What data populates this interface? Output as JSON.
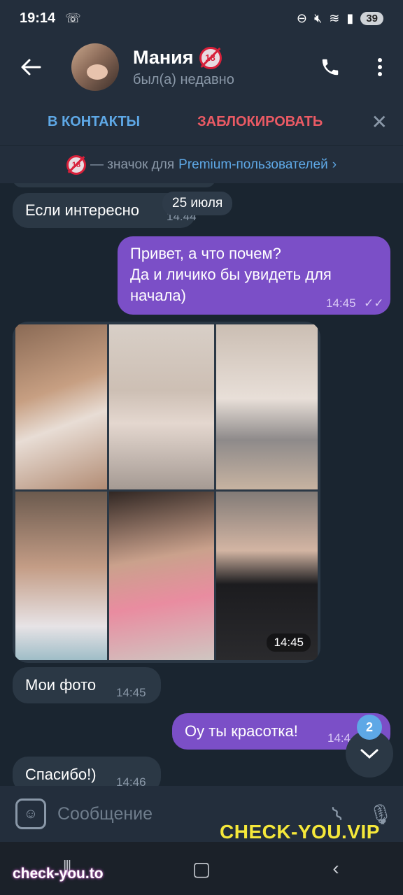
{
  "status_bar": {
    "time": "19:14",
    "battery": "39"
  },
  "header": {
    "back_icon": "arrow-left-icon",
    "name": "Мания",
    "badge_text": "18",
    "status": "был(а) недавно",
    "call_icon": "phone-icon",
    "menu_icon": "more-vertical-icon"
  },
  "actions": {
    "add_contact": "В КОНТАКТЫ",
    "block": "ЗАБЛОКИРОВАТЬ",
    "close": "✕"
  },
  "premium_banner": {
    "badge_text": "18",
    "text": " — значок для ",
    "link": "Premium-пользователей",
    "chevron": "›"
  },
  "date_pill": "25 июля",
  "messages": [
    {
      "direction": "in",
      "text": "Если интересно",
      "time": "14:44"
    },
    {
      "direction": "out",
      "lines": [
        "Привет, а что почем?",
        "Да и личико  бы увидеть для",
        "начала)"
      ],
      "time": "14:45",
      "ticks": "✓✓"
    },
    {
      "direction": "in",
      "type": "media",
      "time": "14:45"
    },
    {
      "direction": "in",
      "text": "Мои фото",
      "time": "14:45"
    },
    {
      "direction": "out",
      "text": "Оу ты красотка!",
      "time": "14:4"
    },
    {
      "direction": "in",
      "text": "Спасибо!)",
      "time": "14:46"
    }
  ],
  "unread": {
    "count": "2",
    "icon": "chevron-down-icon"
  },
  "composer": {
    "placeholder": "Сообщение",
    "emoji_icon": "sticker-icon",
    "attach_icon": "paperclip-icon",
    "mic_icon": "microphone-icon"
  },
  "watermarks": {
    "top": "CHECK-YOU.VIP",
    "bottom": "check-you.to"
  },
  "colors": {
    "accent": "#5ea8e6",
    "danger": "#ea5a64",
    "outgoing": "#7b4fc7",
    "incoming": "#2b3845"
  }
}
